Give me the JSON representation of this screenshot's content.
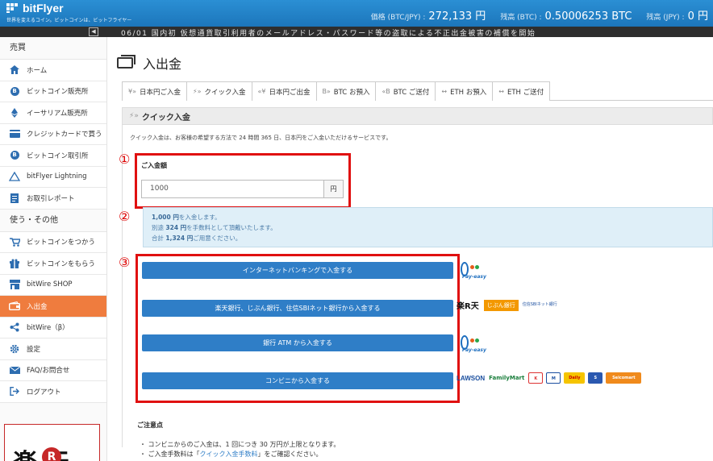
{
  "header": {
    "logo": "bitFlyer",
    "tagline": "世界を変えるコイン。ビットコインは、ビットフライヤー",
    "price_label": "価格 (BTC/JPY) :",
    "price_value": "272,133 円",
    "btc_balance_label": "残高 (BTC) :",
    "btc_balance_value": "0.50006253 BTC",
    "jpy_balance_label": "残高 (JPY) :",
    "jpy_balance_value": "0 円"
  },
  "ticker": {
    "collapse_icon": "◀",
    "text": "06/01 国内初 仮想通貨取引利用者のメールアドレス・パスワード等の盗取による不正出金被害の補償を開始"
  },
  "sidebar": {
    "section_trade": "売買",
    "items_trade": [
      {
        "label": "ホーム",
        "icon": "home-icon"
      },
      {
        "label": "ビットコイン販売所",
        "icon": "bitcoin-icon"
      },
      {
        "label": "イーサリアム販売所",
        "icon": "ethereum-icon"
      },
      {
        "label": "クレジットカードで買う",
        "icon": "credit-card-icon"
      },
      {
        "label": "ビットコイン取引所",
        "icon": "bitcoin-icon"
      },
      {
        "label": "bitFlyer Lightning",
        "icon": "lightning-icon"
      },
      {
        "label": "お取引レポート",
        "icon": "report-icon"
      }
    ],
    "section_other": "使う・その他",
    "items_other": [
      {
        "label": "ビットコインをつかう",
        "icon": "cart-icon"
      },
      {
        "label": "ビットコインをもらう",
        "icon": "gift-icon"
      },
      {
        "label": "bitWire SHOP",
        "icon": "shop-icon"
      },
      {
        "label": "入出金",
        "icon": "wallet-icon"
      },
      {
        "label": "bitWire（β）",
        "icon": "share-icon"
      },
      {
        "label": "設定",
        "icon": "gear-icon"
      },
      {
        "label": "FAQ/お問合せ",
        "icon": "mail-icon"
      },
      {
        "label": "ログアウト",
        "icon": "logout-icon"
      }
    ],
    "banner_text": "楽天"
  },
  "main": {
    "title": "入出金",
    "tabs": [
      {
        "label": "日本円ご入金",
        "icon": "¥»"
      },
      {
        "label": "クイック入金",
        "icon": "⚡»"
      },
      {
        "label": "日本円ご出金",
        "icon": "«¥"
      },
      {
        "label": "BTC お預入",
        "icon": "B»"
      },
      {
        "label": "BTC ご送付",
        "icon": "«B"
      },
      {
        "label": "ETH お預入",
        "icon": "↔"
      },
      {
        "label": "ETH ご送付",
        "icon": "↔"
      }
    ],
    "section_title": "クイック入金",
    "description": "クイック入金は、お客様の希望する方法で 24 時間 365 日、日本円をご入金いただけるサービスです。",
    "annotations": [
      "①",
      "②",
      "③"
    ],
    "amount_label": "ご入金額",
    "amount_value": "1000",
    "amount_unit": "円",
    "info": {
      "line1_amount": "1,000 円",
      "line1_rest": "を入金します。",
      "line2_pre": "別途 ",
      "line2_amount": "324 円",
      "line2_rest": "を手数料として頂戴いたします。",
      "line3_pre": "合計 ",
      "line3_amount": "1,324 円",
      "line3_rest": "ご用意ください。"
    },
    "buttons": [
      "インターネットバンキングで入金する",
      "楽天銀行、じぶん銀行、住信SBIネット銀行から入金する",
      "銀行 ATM から入金する",
      "コンビニから入金する"
    ],
    "logos": {
      "payeasy": "Pay-easy",
      "rakuten": "楽R天",
      "jibun": "じぶん銀行",
      "sbi": "住信SBIネット銀行",
      "lawson": "LAWSON",
      "familymart": "FamilyMart",
      "dailly": "Daily",
      "seicomart": "Seicomart"
    },
    "notes_title": "ご注意点",
    "notes": [
      {
        "pre": "・ コンビニからのご入金は、1 回につき 30 万円が上限となります。",
        "link": "",
        "post": ""
      },
      {
        "pre": "・ ご入金手数料は「",
        "link": "クイック入金手数料",
        "post": "」をご確認ください。"
      }
    ]
  },
  "colors": {
    "header": "#1c76bb",
    "active": "#ef7c3e",
    "button": "#2f7ec7",
    "annotation": "#e01010"
  }
}
